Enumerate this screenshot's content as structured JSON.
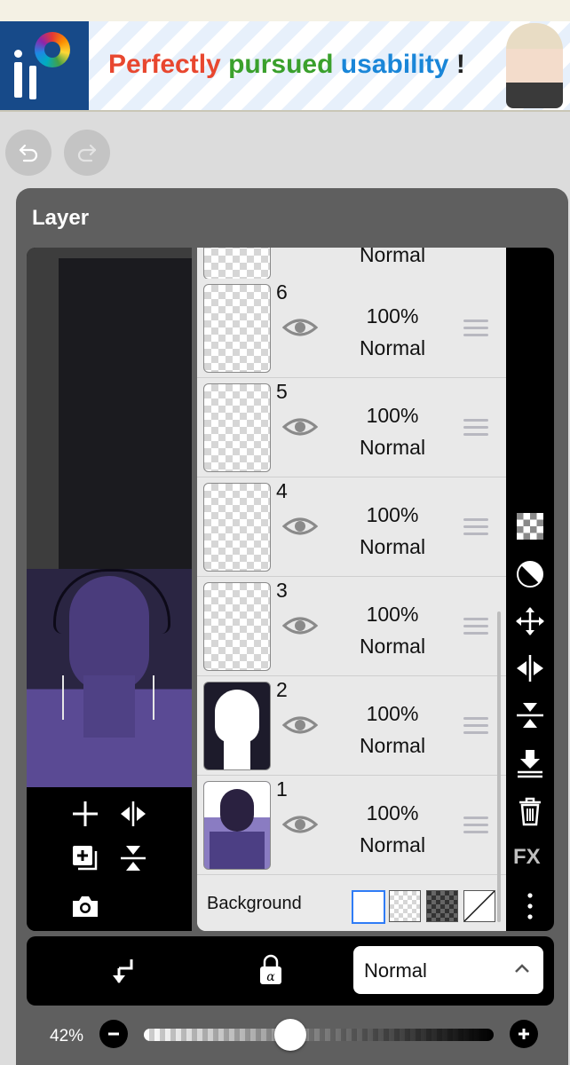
{
  "ad": {
    "text_part1": "Perfectly",
    "text_part2": "pursued",
    "text_part3": "usability",
    "text_part4": "!"
  },
  "panel": {
    "title": "Layer"
  },
  "layers": [
    {
      "number": "",
      "opacity": "",
      "blend": "Normal"
    },
    {
      "number": "6",
      "opacity": "100%",
      "blend": "Normal"
    },
    {
      "number": "5",
      "opacity": "100%",
      "blend": "Normal"
    },
    {
      "number": "4",
      "opacity": "100%",
      "blend": "Normal"
    },
    {
      "number": "3",
      "opacity": "100%",
      "blend": "Normal"
    },
    {
      "number": "2",
      "opacity": "100%",
      "blend": "Normal"
    },
    {
      "number": "1",
      "opacity": "100%",
      "blend": "Normal"
    }
  ],
  "background": {
    "label": "Background"
  },
  "right_toolbar": {
    "fx_label": "FX"
  },
  "bottom_bar": {
    "blend_mode": "Normal"
  },
  "zoom": {
    "value": "42%",
    "slider_fraction": 0.42
  },
  "colors": {
    "accent": "#2f7cf6",
    "panel": "#5f5f5f",
    "list_bg": "#e9e9e9"
  },
  "icons": [
    "undo-icon",
    "redo-icon",
    "add-layer-icon",
    "flip-horizontal-icon",
    "duplicate-layer-icon",
    "flip-vertical-icon",
    "camera-icon",
    "eye-icon",
    "drag-handle-icon",
    "checker-icon",
    "contrast-icon",
    "move-icon",
    "merge-down-icon",
    "trash-icon",
    "more-icon",
    "clip-down-icon",
    "alpha-lock-icon",
    "chevron-up-icon",
    "minus-icon",
    "plus-icon"
  ]
}
